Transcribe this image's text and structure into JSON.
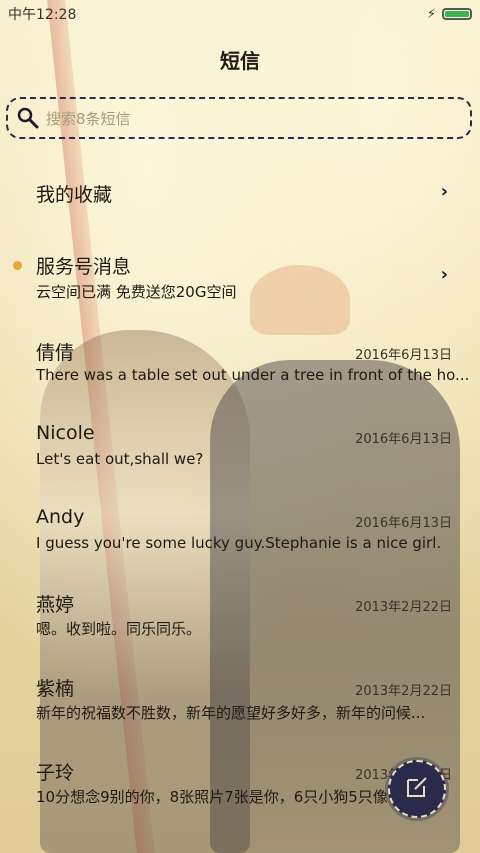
{
  "status_bar": {
    "time": "中午12:28"
  },
  "header": {
    "title": "短信"
  },
  "search": {
    "placeholder": "搜索8条短信"
  },
  "favorites": {
    "label": "我的收藏"
  },
  "service": {
    "label": "服务号消息",
    "preview": "云空间已满 免费送您20G空间"
  },
  "conversations": [
    {
      "name": "倩倩",
      "date": "2016年6月13日",
      "preview": "There was a table set out under a tree in front of the ho..."
    },
    {
      "name": "Nicole",
      "date": "2016年6月13日",
      "preview": "Let's eat out,shall we?"
    },
    {
      "name": "Andy",
      "date": "2016年6月13日",
      "preview": "I guess you're some lucky guy.Stephanie is a nice girl."
    },
    {
      "name": "燕婷",
      "date": "2013年2月22日",
      "preview": "嗯。收到啦。同乐同乐。"
    },
    {
      "name": "紫楠",
      "date": "2013年2月22日",
      "preview": "新年的祝福数不胜数，新年的愿望好多好多，新年的问候..."
    },
    {
      "name": "子玲",
      "date": "2013年2月22日",
      "preview": "10分想念9别的你，8张照片7张是你，6只小狗5只像"
    }
  ],
  "colors": {
    "accent_dot": "#f0a23a",
    "fab": "#2c2a4a",
    "battery": "#3fb34f"
  },
  "icons": {
    "search": "search-icon",
    "compose": "compose-icon",
    "chevron": "chevron-right-icon"
  }
}
